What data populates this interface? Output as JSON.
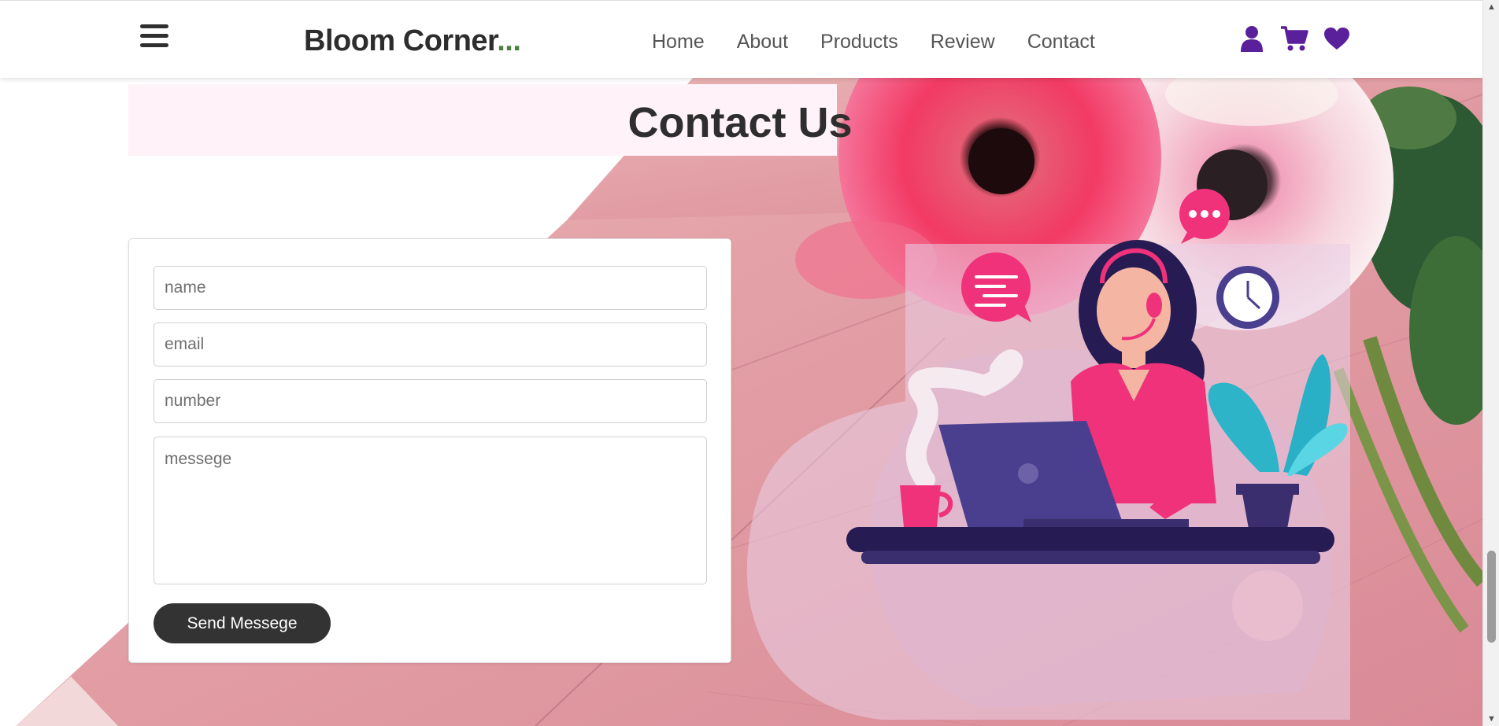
{
  "header": {
    "logo_text": "Bloom Corner",
    "logo_dots": "...",
    "nav": [
      "Home",
      "About",
      "Products",
      "Review",
      "Contact"
    ],
    "icons": [
      "user-icon",
      "shopping-cart-icon",
      "heart-icon"
    ],
    "icon_color": "#5a1f9a"
  },
  "contact": {
    "title": "Contact Us",
    "form": {
      "name_placeholder": "name",
      "email_placeholder": "email",
      "number_placeholder": "number",
      "message_placeholder": "messege",
      "send_label": "Send Messege"
    }
  },
  "colors": {
    "accent_pink": "#f0327a",
    "dark": "#333333",
    "heading_band": "#fff2f8",
    "wood_pink": "#e8a7ad"
  }
}
